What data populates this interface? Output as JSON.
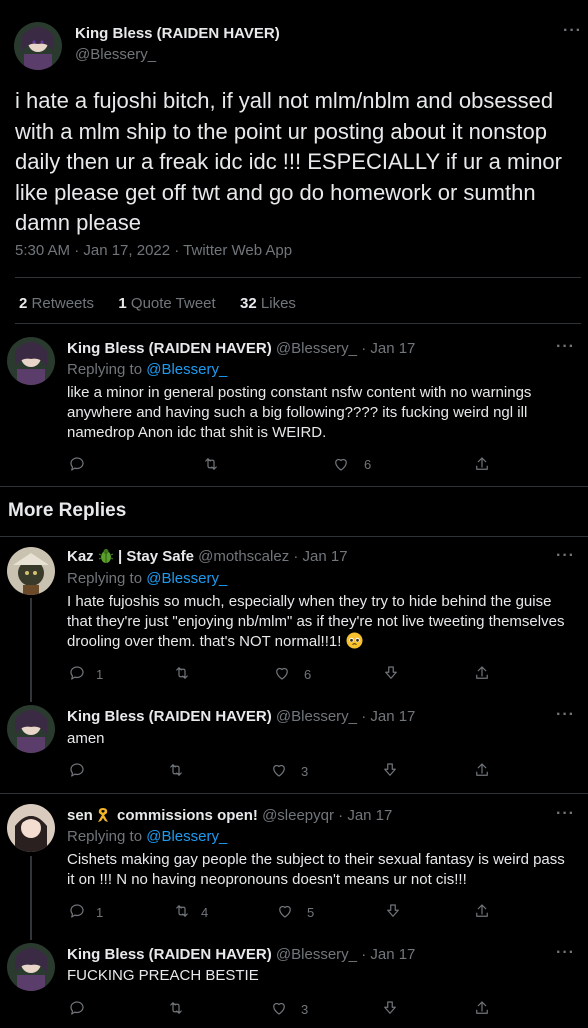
{
  "main_tweet": {
    "name": "King Bless (RAIDEN HAVER)",
    "handle": "@Blessery_",
    "text": "i hate a fujoshi bitch, if yall not mlm/nblm and obsessed with a mlm ship to the point ur posting about it nonstop daily then ur a freak idc idc !!! ESPECIALLY if ur a minor like please get off twt and go do homework or sumthn damn please",
    "timestamp": "5:30 AM · Jan 17, 2022 · Twitter Web App",
    "stats": {
      "retweets_count": "2",
      "retweets_label": "Retweets",
      "quotes_count": "1",
      "quotes_label": "Quote Tweet",
      "likes_count": "32",
      "likes_label": "Likes"
    }
  },
  "self_reply": {
    "name": "King Bless (RAIDEN HAVER)",
    "handle": "@Blessery_",
    "date": "· Jan 17",
    "replying_label": "Replying to",
    "replying_handle": "@Blessery_",
    "text": "like a minor in general posting constant nsfw content with no warnings anywhere and having such a big following???? its fucking weird ngl ill namedrop Anon idc that shit is WEIRD.",
    "likes": "6"
  },
  "more_replies_heading": "More Replies",
  "replies": [
    {
      "name": "Kaz",
      "name_suffix": "| Stay Safe",
      "handle": "@mothscalez",
      "date": "· Jan 17",
      "replying_label": "Replying to",
      "replying_handle": "@Blessery_",
      "text": "I hate fujoshis so much, especially when they try to hide behind the guise that they're just \"enjoying nb/mlm\" as if they're not live tweeting themselves drooling over them. that's NOT normal!!1!",
      "replies": "1",
      "likes": "6"
    },
    {
      "name": "King Bless (RAIDEN HAVER)",
      "handle": "@Blessery_",
      "date": "· Jan 17",
      "text": "amen",
      "likes": "3"
    },
    {
      "name": "sen",
      "name_suffix": "commissions open!",
      "handle": "@sleepyqr",
      "date": "· Jan 17",
      "replying_label": "Replying to",
      "replying_handle": "@Blessery_",
      "text": "Cishets making gay people the subject to their sexual fantasy is weird pass it on !!! N no having neopronouns doesn't means ur not cis!!!",
      "replies": "1",
      "retweets": "4",
      "likes": "5"
    },
    {
      "name": "King Bless (RAIDEN HAVER)",
      "handle": "@Blessery_",
      "date": "· Jan 17",
      "text": "FUCKING PREACH BESTIE",
      "likes": "3"
    }
  ],
  "colors": {
    "background": "#000000",
    "text": "#e7e9ea",
    "muted": "#71767b",
    "link": "#1d9bf0",
    "divider": "#2f3336"
  },
  "icons": [
    "more-icon",
    "reply-icon",
    "retweet-icon",
    "like-icon",
    "share-icon",
    "downvote-icon",
    "bug-emoji-icon",
    "ribbon-emoji-icon",
    "pleading-emoji-icon"
  ]
}
